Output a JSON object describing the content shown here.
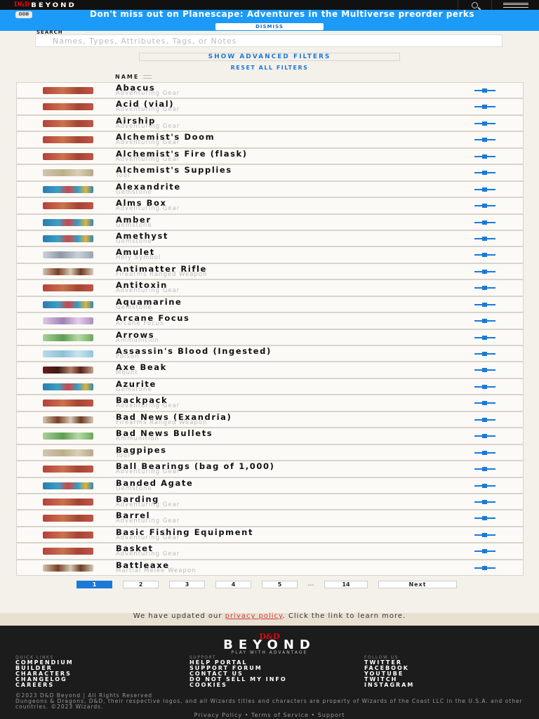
{
  "nav": {
    "brand_dd": "D&D",
    "brand_beyond": "BEYOND"
  },
  "promo": {
    "logo": "DDB",
    "text": "Don't miss out on Planescape: Adventures in the Multiverse preorder perks",
    "dismiss": "DISMISS"
  },
  "search": {
    "label": "SEARCH",
    "placeholder": "Names, Types, Attributes, Tags, or Notes"
  },
  "filters": {
    "advanced": "SHOW ADVANCED FILTERS",
    "reset": "RESET ALL FILTERS"
  },
  "list_header": {
    "name": "NAME"
  },
  "items": [
    {
      "name": "Abacus",
      "type": "Adventuring Gear",
      "thumb": "gear"
    },
    {
      "name": "Acid (vial)",
      "type": "Adventuring Gear",
      "thumb": "gear"
    },
    {
      "name": "Airship",
      "type": "Adventuring Gear",
      "thumb": "gear"
    },
    {
      "name": "Alchemist's Doom",
      "type": "Adventuring Gear",
      "thumb": "gear"
    },
    {
      "name": "Alchemist's Fire (flask)",
      "type": "Adventuring Gear",
      "thumb": "gear"
    },
    {
      "name": "Alchemist's Supplies",
      "type": "Tool",
      "thumb": "tool"
    },
    {
      "name": "Alexandrite",
      "type": "Gemstone",
      "thumb": "gem"
    },
    {
      "name": "Alms Box",
      "type": "Adventuring Gear",
      "thumb": "gear"
    },
    {
      "name": "Amber",
      "type": "Gemstone",
      "thumb": "gem"
    },
    {
      "name": "Amethyst",
      "type": "Gemstone",
      "thumb": "gem"
    },
    {
      "name": "Amulet",
      "type": "Holy Symbol",
      "thumb": "holy"
    },
    {
      "name": "Antimatter Rifle",
      "type": "Firearms Ranged Weapon",
      "thumb": "firearm"
    },
    {
      "name": "Antitoxin",
      "type": "Adventuring Gear",
      "thumb": "gear"
    },
    {
      "name": "Aquamarine",
      "type": "Gemstone",
      "thumb": "gem"
    },
    {
      "name": "Arcane Focus",
      "type": "Arcane Focus",
      "thumb": "arcane"
    },
    {
      "name": "Arrows",
      "type": "Ammunition",
      "thumb": "ammo"
    },
    {
      "name": "Assassin's Blood (Ingested)",
      "type": "Poison",
      "thumb": "poison"
    },
    {
      "name": "Axe Beak",
      "type": "Mount",
      "thumb": "mount"
    },
    {
      "name": "Azurite",
      "type": "Gemstone",
      "thumb": "gem"
    },
    {
      "name": "Backpack",
      "type": "Adventuring Gear",
      "thumb": "gear"
    },
    {
      "name": "Bad News (Exandria)",
      "type": "Firearms Ranged Weapon",
      "thumb": "firearm"
    },
    {
      "name": "Bad News Bullets",
      "type": "Ammunition",
      "thumb": "ammo"
    },
    {
      "name": "Bagpipes",
      "type": "Tool",
      "thumb": "tool"
    },
    {
      "name": "Ball Bearings (bag of 1,000)",
      "type": "Adventuring Gear",
      "thumb": "gear"
    },
    {
      "name": "Banded Agate",
      "type": "Gemstone",
      "thumb": "gem"
    },
    {
      "name": "Barding",
      "type": "Adventuring Gear",
      "thumb": "gear"
    },
    {
      "name": "Barrel",
      "type": "Adventuring Gear",
      "thumb": "gear"
    },
    {
      "name": "Basic Fishing Equipment",
      "type": "Adventuring Gear",
      "thumb": "gear"
    },
    {
      "name": "Basket",
      "type": "Adventuring Gear",
      "thumb": "gear"
    },
    {
      "name": "Battleaxe",
      "type": "Martial Melee Weapon",
      "thumb": "firearm"
    }
  ],
  "pagination": {
    "pages": [
      "1",
      "2",
      "3",
      "4",
      "5"
    ],
    "ellipsis": "...",
    "last": "14",
    "next": "Next",
    "current": "1"
  },
  "notice": {
    "before": "We have updated our ",
    "link": "privacy policy",
    "after": ". Click the link to learn more."
  },
  "footer": {
    "logo_dd": "D&D",
    "logo_beyond": "BEYOND",
    "tagline": "PLAY WITH ADVANTAGE",
    "quick_links_head": "QUICK LINKS",
    "quick_links": [
      "COMPENDIUM",
      "BUILDER",
      "CHARACTERS",
      "CHANGELOG",
      "CAREERS"
    ],
    "support_head": "SUPPORT",
    "support": [
      "HELP PORTAL",
      "SUPPORT FORUM",
      "CONTACT US",
      "DO NOT SELL MY INFO",
      "COOKIES"
    ],
    "follow_head": "FOLLOW US",
    "follow": [
      "TWITTER",
      "FACEBOOK",
      "YOUTUBE",
      "TWITCH",
      "INSTAGRAM"
    ],
    "copyright": "©2023 D&D Beyond | All Rights Reserved",
    "legal_text": "Dungeons & Dragons, D&D, their respective logos, and all Wizards titles and characters are property of Wizards of the Coast LLC in the U.S.A. and other countries. ©2023 Wizards.",
    "privacy": "Privacy Policy",
    "terms": "Terms of Service",
    "support_link": "Support",
    "sep": "•"
  }
}
